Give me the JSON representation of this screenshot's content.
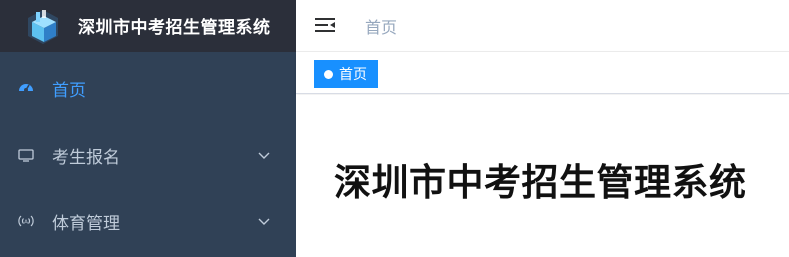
{
  "app": {
    "title": "深圳市中考招生管理系统"
  },
  "sidebar": {
    "items": [
      {
        "label": "首页",
        "icon": "dashboard-icon",
        "active": true,
        "has_children": false
      },
      {
        "label": "考生报名",
        "icon": "monitor-icon",
        "active": false,
        "has_children": true
      },
      {
        "label": "体育管理",
        "icon": "broadcast-icon",
        "active": false,
        "has_children": true
      }
    ]
  },
  "navbar": {
    "breadcrumb": "首页",
    "toggle_icon": "hamburger-icon"
  },
  "tags": [
    {
      "label": "首页",
      "active": true
    }
  ],
  "main": {
    "heading": "深圳市中考招生管理系统"
  },
  "colors": {
    "sidebar_bg": "#304156",
    "logo_bg": "#2b2f3a",
    "accent": "#409eff",
    "tag_bg": "#1890ff",
    "menu_text": "#bfcbd9"
  }
}
